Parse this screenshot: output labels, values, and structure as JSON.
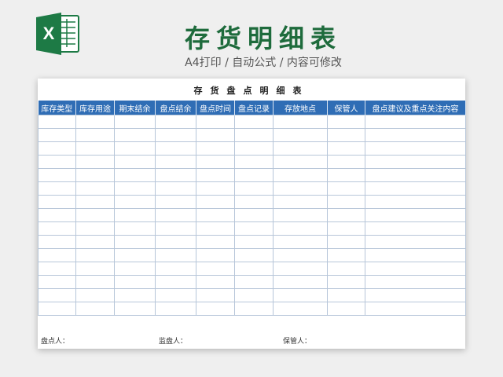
{
  "header": {
    "title": "存货明细表",
    "subtitle": "A4打印 / 自动公式 / 内容可修改"
  },
  "sheet": {
    "title": "存货盘点明细表",
    "columns": [
      "库存类型",
      "库存用途",
      "期末结余",
      "盘点结余",
      "盘点时间",
      "盘点记录",
      "存放地点",
      "保管人",
      "盘点建议及重点关注内容"
    ],
    "empty_row_count": 15
  },
  "footer": {
    "counter": "盘点人：",
    "supervisor": "监盘人：",
    "keeper": "保管人："
  },
  "colors": {
    "header_bg": "#2f6db5",
    "title_green": "#1e6b3c",
    "excel_green": "#1d7a45"
  }
}
